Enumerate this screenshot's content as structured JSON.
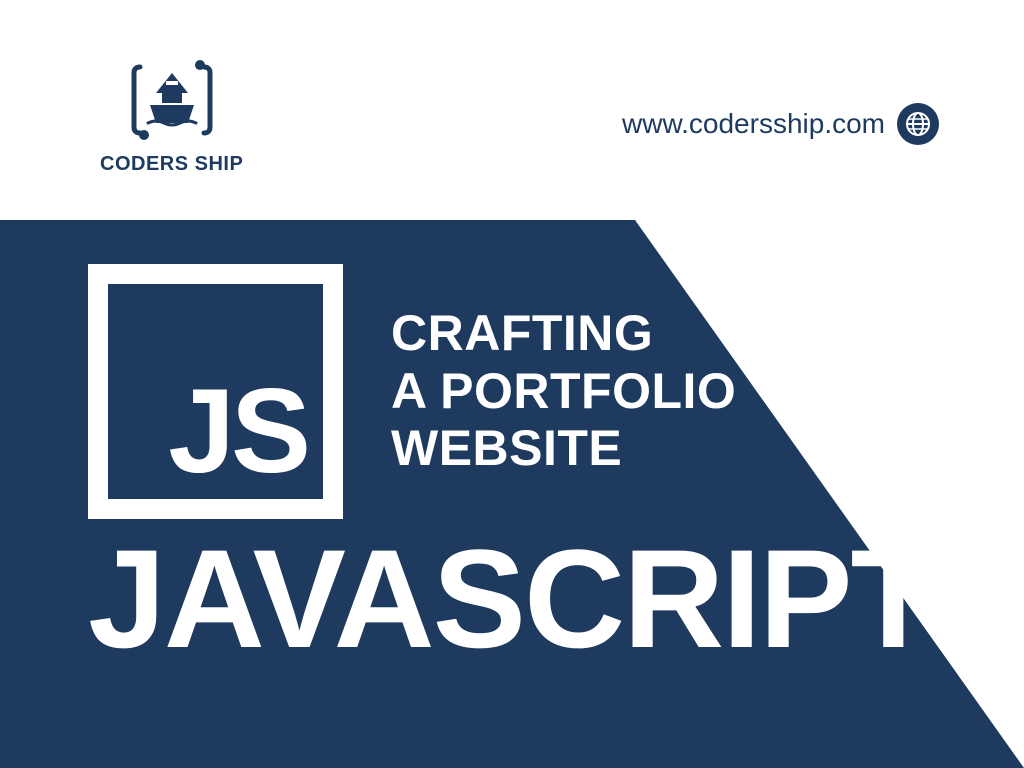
{
  "brand": {
    "name": "CODERS SHIP",
    "url": "www.codersship.com"
  },
  "hero": {
    "badge": "JS",
    "tagline_line1": "CRAFTING",
    "tagline_line2": "A PORTFOLIO",
    "tagline_line3": "WEBSITE",
    "title": "JAVASCRIPT"
  },
  "colors": {
    "navy": "#1e3a5f",
    "white": "#ffffff"
  }
}
